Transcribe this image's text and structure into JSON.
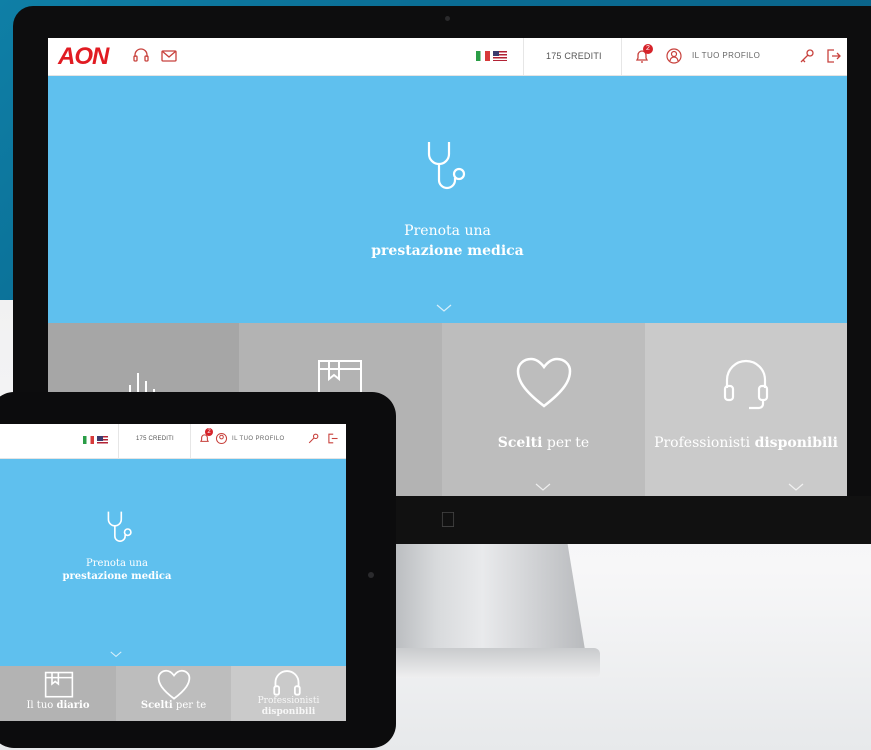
{
  "colors": {
    "brand_red": "#e11b22",
    "hero_blue": "#5fc0ee",
    "tile_1": "#a6a6a6",
    "tile_2": "#b3b3b3",
    "tile_3": "#bdbdbd",
    "tile_4": "#cacaca"
  },
  "header": {
    "logo": "AON",
    "credits": "175 CREDITI",
    "notification_count": "2",
    "profile_label": "IL TUO PROFILO",
    "icons": [
      "headset-icon",
      "mail-icon",
      "flag-italy-icon",
      "flag-us-icon",
      "bell-icon",
      "user-icon",
      "key-icon",
      "logout-icon"
    ]
  },
  "hero": {
    "line1": "Prenota una",
    "line2": "prestazione medica",
    "icon": "stethoscope-icon"
  },
  "desktop_tiles": [
    {
      "icon": "bar-chart-icon",
      "label_plain": "",
      "label_bold": ""
    },
    {
      "icon": "diary-icon",
      "label_plain": "",
      "label_bold": ""
    },
    {
      "icon": "heart-icon",
      "label_bold": "Scelti",
      "label_plain": " per te"
    },
    {
      "icon": "headset-icon",
      "label_plain": "Professionisti ",
      "label_bold": "disponibili"
    }
  ],
  "tablet_tiles": [
    {
      "icon": "diary-icon",
      "label_plain": "Il tuo ",
      "label_bold": "diario"
    },
    {
      "icon": "heart-icon",
      "label_bold": "Scelti",
      "label_plain": " per te"
    },
    {
      "icon": "headset-icon",
      "label_plain": "Professionisti",
      "label_bold": "disponibili"
    }
  ]
}
